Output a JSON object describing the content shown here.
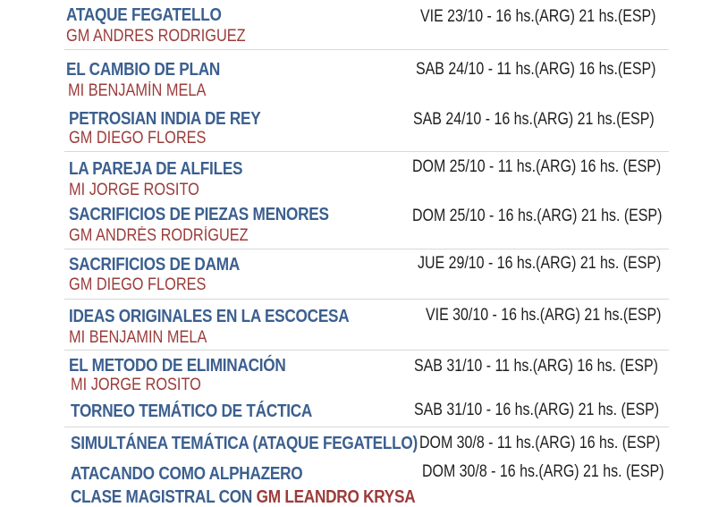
{
  "events": [
    {
      "title": "ATAQUE FEGATELLO",
      "speaker": "GM ANDRES RODRIGUEZ",
      "when": "VIE 23/10 - 16 hs.(ARG)  21 hs.(ESP)"
    },
    {
      "title": "EL CAMBIO DE PLAN",
      "speaker": "MI BENJAMÍN MELA",
      "when": "SAB 24/10 - 11 hs.(ARG) 16 hs.(ESP)"
    },
    {
      "title": "PETROSIAN INDIA DE REY",
      "speaker": "GM DIEGO FLORES",
      "when": "SAB 24/10 - 16 hs.(ARG)  21 hs.(ESP)"
    },
    {
      "title": "LA PAREJA DE ALFILES",
      "speaker": "MI JORGE ROSITO",
      "when": "DOM 25/10 - 11 hs.(ARG) 16 hs. (ESP)"
    },
    {
      "title": "SACRIFICIOS DE PIEZAS MENORES",
      "speaker": "GM ANDRÉS RODRÍGUEZ",
      "when": "DOM 25/10 - 16 hs.(ARG) 21 hs. (ESP)"
    },
    {
      "title": "SACRIFICIOS DE DAMA",
      "speaker": "GM DIEGO FLORES",
      "when": "JUE 29/10 - 16 hs.(ARG) 21 hs. (ESP)"
    },
    {
      "title": "IDEAS ORIGINALES EN LA ESCOCESA",
      "speaker": "MI BENJAMIN MELA",
      "when": "VIE 30/10 - 16 hs.(ARG) 21 hs.(ESP)"
    },
    {
      "title": "EL METODO DE ELIMINACIÓN",
      "speaker": "MI JORGE ROSITO",
      "when": "SAB 31/10 - 11 hs.(ARG) 16 hs. (ESP)"
    },
    {
      "title": "TORNEO TEMÁTICO DE TÁCTICA",
      "speaker": "",
      "when": "SAB 31/10 - 16 hs.(ARG) 21 hs. (ESP)"
    },
    {
      "title": "SIMULTÁNEA TEMÁTICA (ATAQUE FEGATELLO)",
      "speaker": "",
      "when": "DOM 30/8 - 11 hs.(ARG) 16 hs. (ESP)"
    },
    {
      "title": "ATACANDO COMO ALPHAZERO",
      "speaker": "",
      "when": "DOM 30/8 - 16 hs.(ARG) 21 hs. (ESP)"
    }
  ],
  "masterclass": {
    "prefix": "CLASE MAGISTRAL CON ",
    "speaker": "GM LEANDRO KRYSA"
  },
  "colors": {
    "title": "#3b5f8f",
    "speaker": "#9b3b3a",
    "time": "#1f1f1f"
  }
}
